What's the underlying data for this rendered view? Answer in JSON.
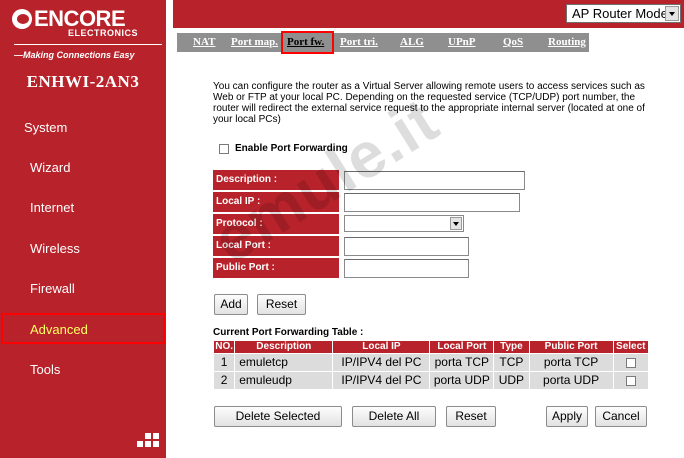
{
  "brand": {
    "logo_text": "ENCORE",
    "logo_subtext": "ELECTRONICS",
    "tagline": "—Making Connections Easy",
    "model": "ENHWI-2AN3"
  },
  "sidebar": {
    "items": [
      {
        "label": "System"
      },
      {
        "label": "Wizard"
      },
      {
        "label": "Internet"
      },
      {
        "label": "Wireless"
      },
      {
        "label": "Firewall"
      },
      {
        "label": "Advanced"
      },
      {
        "label": "Tools"
      }
    ],
    "active": "Advanced",
    "active_color": "#ffff66"
  },
  "header": {
    "mode_select": {
      "selected": "AP Router Mode"
    }
  },
  "tabs": [
    {
      "label": "NAT"
    },
    {
      "label": "Port map."
    },
    {
      "label": "Port fw."
    },
    {
      "label": "Port tri."
    },
    {
      "label": "ALG"
    },
    {
      "label": "UPnP"
    },
    {
      "label": "QoS"
    },
    {
      "label": "Routing"
    }
  ],
  "active_tab": "Port fw.",
  "content": {
    "description": "You can configure the router as a Virtual Server allowing remote users to access services such as Web or FTP at your local PC. Depending on the requested service (TCP/UDP) port number, the router will redirect the external service request to the appropriate internal server (located at one of your local PCs)",
    "enable_label": "Enable Port Forwarding",
    "enable_checked": false,
    "form": {
      "description_label": "Description :",
      "local_ip_label": "Local IP :",
      "protocol_label": "Protocol :",
      "local_port_label": "Local Port :",
      "public_port_label": "Public Port :",
      "description_value": "",
      "local_ip_value": "",
      "protocol_value": "",
      "local_port_value": "",
      "public_port_value": ""
    },
    "buttons": {
      "add": "Add",
      "reset": "Reset",
      "delete_selected": "Delete Selected",
      "delete_all": "Delete All",
      "reset_table": "Reset",
      "apply": "Apply",
      "cancel": "Cancel"
    },
    "table": {
      "title": "Current Port Forwarding Table :",
      "headers": [
        "NO.",
        "Description",
        "Local IP",
        "Local Port",
        "Type",
        "Public Port",
        "Select"
      ],
      "rows": [
        [
          "1",
          "emuletcp",
          "IP/IPV4 del PC",
          "porta TCP",
          "TCP",
          "porta TCP"
        ],
        [
          "2",
          "emuleudp",
          "IP/IPV4 del PC",
          "porta UDP",
          "UDP",
          "porta UDP"
        ]
      ]
    }
  },
  "watermark": "emule.it",
  "colors": {
    "brand_red": "#b8222a",
    "tab_gray": "#8f8f8f",
    "highlight_red": "#ff0000",
    "row_gray": "#dcdcdc"
  }
}
